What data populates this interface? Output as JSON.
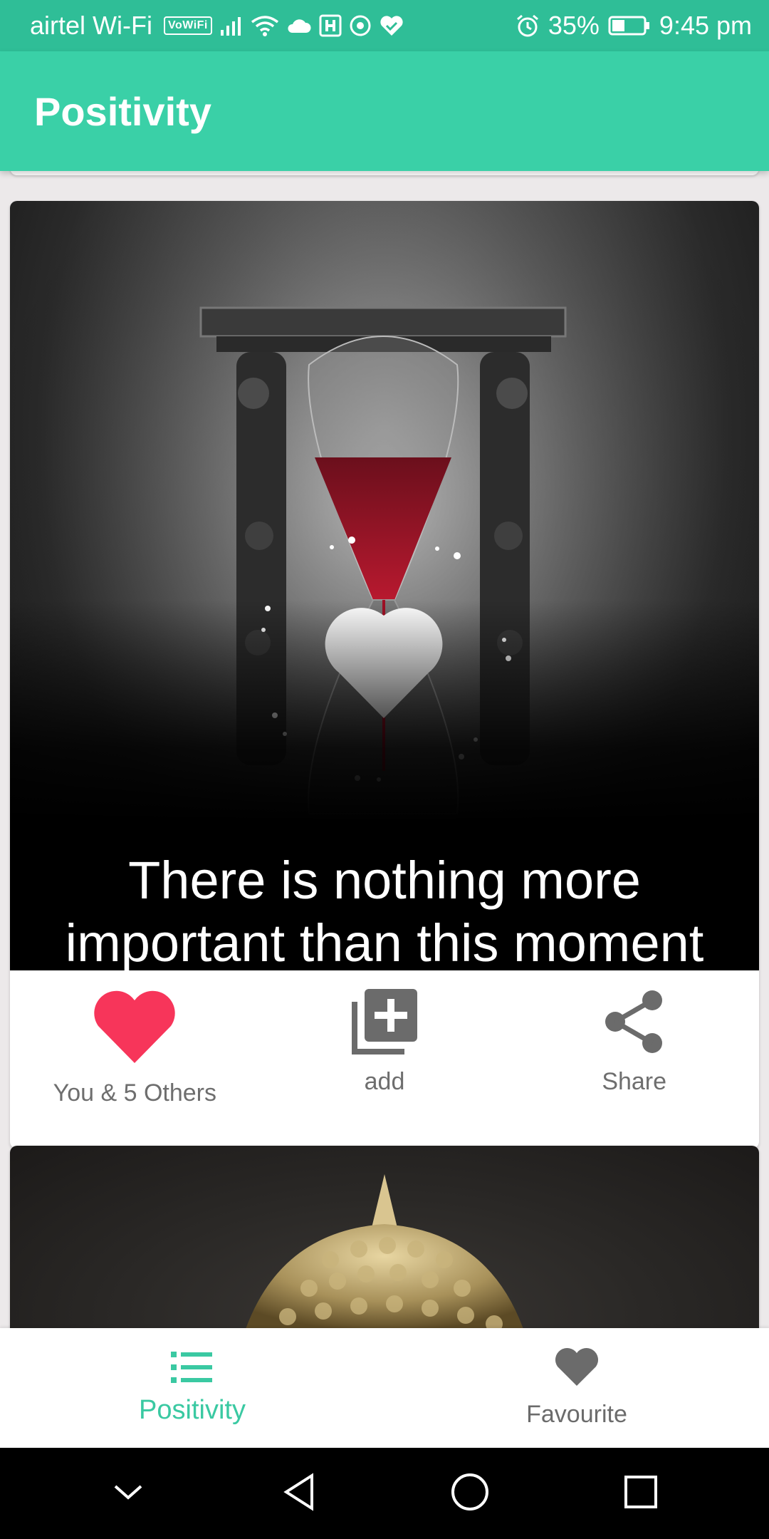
{
  "status_bar": {
    "carrier": "airtel Wi-Fi",
    "vowifi": "VoWiFi",
    "battery_percent": "35%",
    "time": "9:45 pm"
  },
  "app_bar": {
    "title": "Positivity"
  },
  "feed": {
    "cards": [
      {
        "quote": "There is nothing more important than this moment",
        "actions": {
          "like_label": "You & 5 Others",
          "add_label": "add",
          "share_label": "Share"
        }
      }
    ]
  },
  "bottom_nav": {
    "items": [
      {
        "label": "Positivity",
        "icon": "list-icon",
        "active": true
      },
      {
        "label": "Favourite",
        "icon": "heart-icon",
        "active": false
      }
    ]
  },
  "colors": {
    "status_bar": "#2fbe97",
    "app_bar": "#3ad0a7",
    "accent": "#3ac9a2",
    "like_heart": "#f7355a"
  }
}
